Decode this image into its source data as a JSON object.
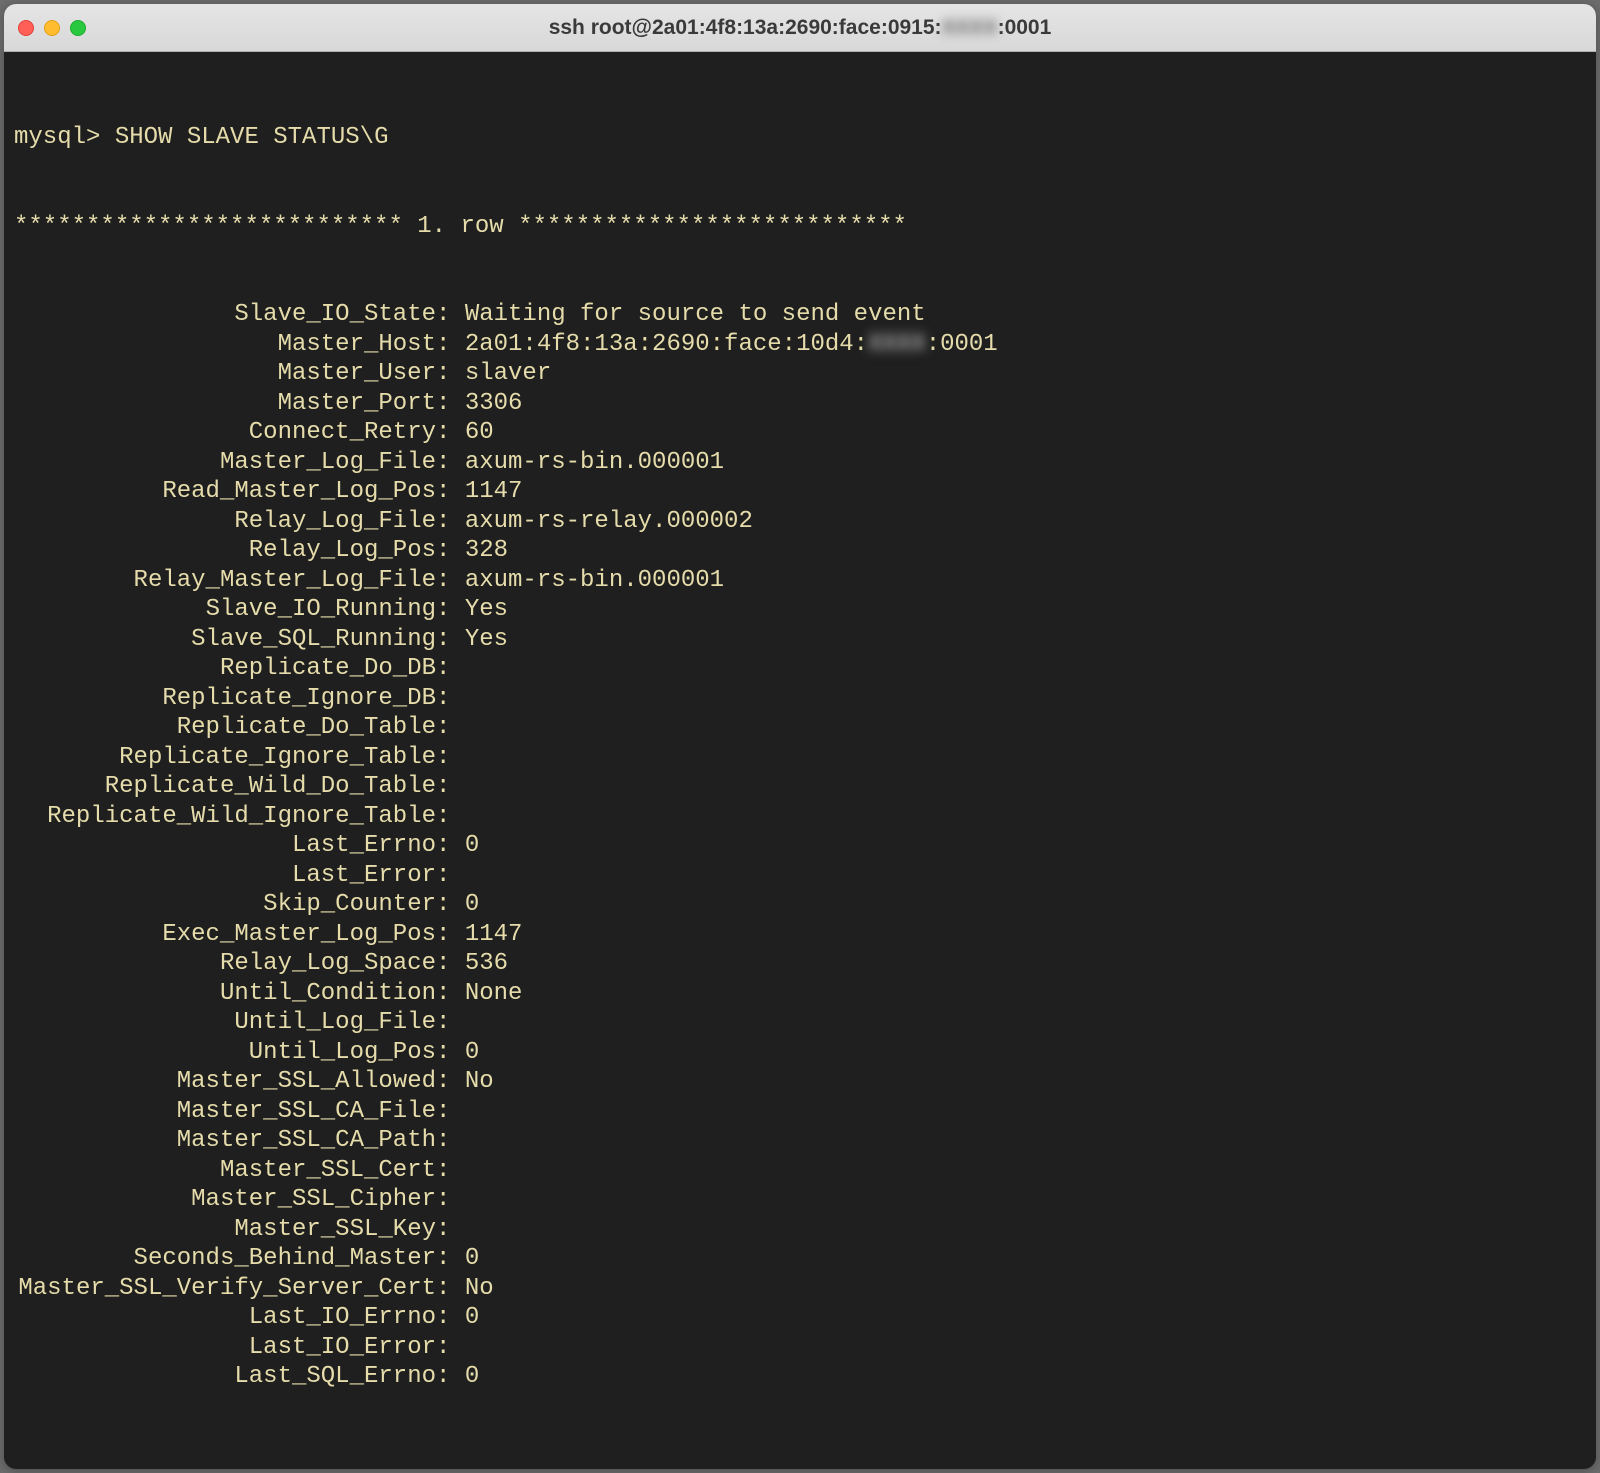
{
  "window": {
    "title_prefix": "ssh root@2a01:4f8:13a:2690:face:0915:",
    "title_blur": "XXXX",
    "title_suffix": ":0001"
  },
  "prompt": {
    "ps": "mysql>",
    "command": "SHOW SLAVE STATUS\\G"
  },
  "row_header": "*************************** 1. row ***************************",
  "host_blur": "XXXX",
  "fields": [
    {
      "k": "Slave_IO_State",
      "v": "Waiting for source to send event"
    },
    {
      "k": "Master_Host",
      "v_pre": "2a01:4f8:13a:2690:face:10d4:",
      "v_blur": "XXXX",
      "v_post": ":0001",
      "has_blur": true
    },
    {
      "k": "Master_User",
      "v": "slaver"
    },
    {
      "k": "Master_Port",
      "v": "3306"
    },
    {
      "k": "Connect_Retry",
      "v": "60"
    },
    {
      "k": "Master_Log_File",
      "v": "axum-rs-bin.000001"
    },
    {
      "k": "Read_Master_Log_Pos",
      "v": "1147"
    },
    {
      "k": "Relay_Log_File",
      "v": "axum-rs-relay.000002"
    },
    {
      "k": "Relay_Log_Pos",
      "v": "328"
    },
    {
      "k": "Relay_Master_Log_File",
      "v": "axum-rs-bin.000001"
    },
    {
      "k": "Slave_IO_Running",
      "v": "Yes"
    },
    {
      "k": "Slave_SQL_Running",
      "v": "Yes"
    },
    {
      "k": "Replicate_Do_DB",
      "v": ""
    },
    {
      "k": "Replicate_Ignore_DB",
      "v": ""
    },
    {
      "k": "Replicate_Do_Table",
      "v": ""
    },
    {
      "k": "Replicate_Ignore_Table",
      "v": ""
    },
    {
      "k": "Replicate_Wild_Do_Table",
      "v": ""
    },
    {
      "k": "Replicate_Wild_Ignore_Table",
      "v": ""
    },
    {
      "k": "Last_Errno",
      "v": "0"
    },
    {
      "k": "Last_Error",
      "v": ""
    },
    {
      "k": "Skip_Counter",
      "v": "0"
    },
    {
      "k": "Exec_Master_Log_Pos",
      "v": "1147"
    },
    {
      "k": "Relay_Log_Space",
      "v": "536"
    },
    {
      "k": "Until_Condition",
      "v": "None"
    },
    {
      "k": "Until_Log_File",
      "v": ""
    },
    {
      "k": "Until_Log_Pos",
      "v": "0"
    },
    {
      "k": "Master_SSL_Allowed",
      "v": "No"
    },
    {
      "k": "Master_SSL_CA_File",
      "v": ""
    },
    {
      "k": "Master_SSL_CA_Path",
      "v": ""
    },
    {
      "k": "Master_SSL_Cert",
      "v": ""
    },
    {
      "k": "Master_SSL_Cipher",
      "v": ""
    },
    {
      "k": "Master_SSL_Key",
      "v": ""
    },
    {
      "k": "Seconds_Behind_Master",
      "v": "0"
    },
    {
      "k": "Master_SSL_Verify_Server_Cert",
      "v": "No"
    },
    {
      "k": "Last_IO_Errno",
      "v": "0"
    },
    {
      "k": "Last_IO_Error",
      "v": ""
    },
    {
      "k": "Last_SQL_Errno",
      "v": "0"
    }
  ]
}
